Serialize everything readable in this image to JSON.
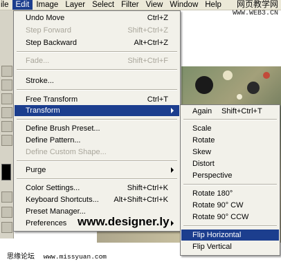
{
  "menubar": {
    "items": [
      {
        "label": "ile"
      },
      {
        "label": "Edit"
      },
      {
        "label": "Image"
      },
      {
        "label": "Layer"
      },
      {
        "label": "Select"
      },
      {
        "label": "Filter"
      },
      {
        "label": "View"
      },
      {
        "label": "Window"
      },
      {
        "label": "Help"
      }
    ]
  },
  "watermark_top": {
    "line1": "网页教学网",
    "line2": "WWW.WEB3.CN"
  },
  "edit_menu": {
    "undo": {
      "label": "Undo Move",
      "shortcut": "Ctrl+Z"
    },
    "step_forward": {
      "label": "Step Forward",
      "shortcut": "Shift+Ctrl+Z"
    },
    "step_backward": {
      "label": "Step Backward",
      "shortcut": "Alt+Ctrl+Z"
    },
    "fade": {
      "label": "Fade...",
      "shortcut": "Shift+Ctrl+F"
    },
    "stroke": {
      "label": "Stroke..."
    },
    "free_transform": {
      "label": "Free Transform",
      "shortcut": "Ctrl+T"
    },
    "transform": {
      "label": "Transform"
    },
    "define_brush": {
      "label": "Define Brush Preset..."
    },
    "define_pattern": {
      "label": "Define Pattern..."
    },
    "define_shape": {
      "label": "Define Custom Shape..."
    },
    "purge": {
      "label": "Purge"
    },
    "color_settings": {
      "label": "Color Settings...",
      "shortcut": "Shift+Ctrl+K"
    },
    "keyboard_shortcuts": {
      "label": "Keyboard Shortcuts...",
      "shortcut": "Alt+Shift+Ctrl+K"
    },
    "preset_manager": {
      "label": "Preset Manager..."
    },
    "preferences": {
      "label": "Preferences"
    }
  },
  "transform_submenu": {
    "again": {
      "label": "Again",
      "shortcut": "Shift+Ctrl+T"
    },
    "scale": {
      "label": "Scale"
    },
    "rotate": {
      "label": "Rotate"
    },
    "skew": {
      "label": "Skew"
    },
    "distort": {
      "label": "Distort"
    },
    "perspective": {
      "label": "Perspective"
    },
    "rotate_180": {
      "label": "Rotate 180°"
    },
    "rotate_90_cw": {
      "label": "Rotate 90° CW"
    },
    "rotate_90_ccw": {
      "label": "Rotate 90° CCW"
    },
    "flip_horizontal": {
      "label": "Flip Horizontal"
    },
    "flip_vertical": {
      "label": "Flip Vertical"
    }
  },
  "watermark_designer": "www.designer.ly",
  "watermark_footer": {
    "left": "思缘论坛",
    "right": "www.missyuan.com"
  },
  "colors": {
    "menu_highlight": "#1c3e8e",
    "menu_bg": "#f2f1ea",
    "disabled_text": "#a9a69b"
  }
}
